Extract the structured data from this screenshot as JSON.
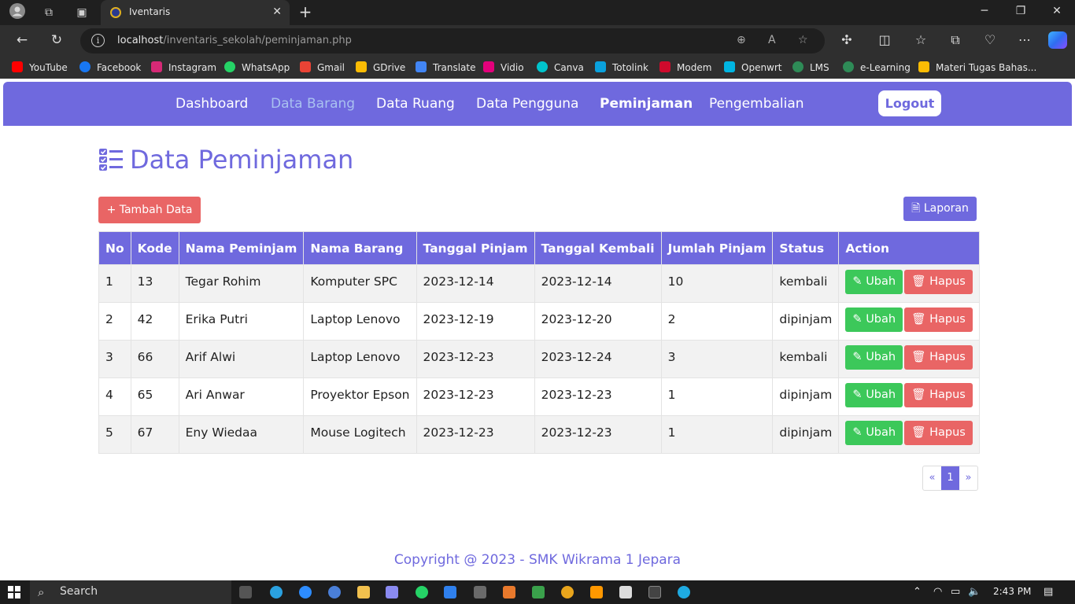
{
  "browser": {
    "tab_title": "Iventaris",
    "url_host": "localhost",
    "url_path": "/inventaris_sekolah/peminjaman.php",
    "bookmarks": [
      {
        "label": "YouTube",
        "color": "#ff0000"
      },
      {
        "label": "Facebook",
        "color": "#1877f2"
      },
      {
        "label": "Instagram",
        "color": "#d62976"
      },
      {
        "label": "WhatsApp",
        "color": "#25d366"
      },
      {
        "label": "Gmail",
        "color": "#ea4335"
      },
      {
        "label": "GDrive",
        "color": "#fbbc04"
      },
      {
        "label": "Translate",
        "color": "#4285f4"
      },
      {
        "label": "Vidio",
        "color": "#e3007b"
      },
      {
        "label": "Canva",
        "color": "#00c4cc"
      },
      {
        "label": "Totolink",
        "color": "#0aa1dd"
      },
      {
        "label": "Modem",
        "color": "#cf0a2c"
      },
      {
        "label": "Openwrt",
        "color": "#00b5e2"
      },
      {
        "label": "LMS",
        "color": "#2e8b57"
      },
      {
        "label": "e-Learning",
        "color": "#2e8b57"
      },
      {
        "label": "Materi Tugas Bahas...",
        "color": "#fbbc04"
      }
    ]
  },
  "nav": {
    "items": [
      "Dashboard",
      "Data Barang",
      "Data Ruang",
      "Data Pengguna",
      "Peminjaman",
      "Pengembalian"
    ],
    "logout": "Logout"
  },
  "page": {
    "title": "Data Peminjaman",
    "add_button": "+ Tambah Data",
    "report_button": "Laporan"
  },
  "table": {
    "headers": [
      "No",
      "Kode",
      "Nama Peminjam",
      "Nama Barang",
      "Tanggal Pinjam",
      "Tanggal Kembali",
      "Jumlah Pinjam",
      "Status",
      "Action"
    ],
    "edit_label": "Ubah",
    "delete_label": "Hapus",
    "rows": [
      [
        "1",
        "13",
        "Tegar Rohim",
        "Komputer SPC",
        "2023-12-14",
        "2023-12-14",
        "10",
        "kembali"
      ],
      [
        "2",
        "42",
        "Erika Putri",
        "Laptop Lenovo",
        "2023-12-19",
        "2023-12-20",
        "2",
        "dipinjam"
      ],
      [
        "3",
        "66",
        "Arif Alwi",
        "Laptop Lenovo",
        "2023-12-23",
        "2023-12-24",
        "3",
        "kembali"
      ],
      [
        "4",
        "65",
        "Ari Anwar",
        "Proyektor Epson",
        "2023-12-23",
        "2023-12-23",
        "1",
        "dipinjam"
      ],
      [
        "5",
        "67",
        "Eny Wiedaa",
        "Mouse Logitech",
        "2023-12-23",
        "2023-12-23",
        "1",
        "dipinjam"
      ]
    ]
  },
  "pagination": {
    "prev": "«",
    "current": "1",
    "next": "»"
  },
  "footer": "Copyright @ 2023 - SMK Wikrama 1 Jepara",
  "taskbar": {
    "search_label": "Search",
    "time": "2:43 PM"
  },
  "colors": {
    "accent": "#6f69de",
    "danger": "#e96565",
    "success": "#3cc85a"
  }
}
